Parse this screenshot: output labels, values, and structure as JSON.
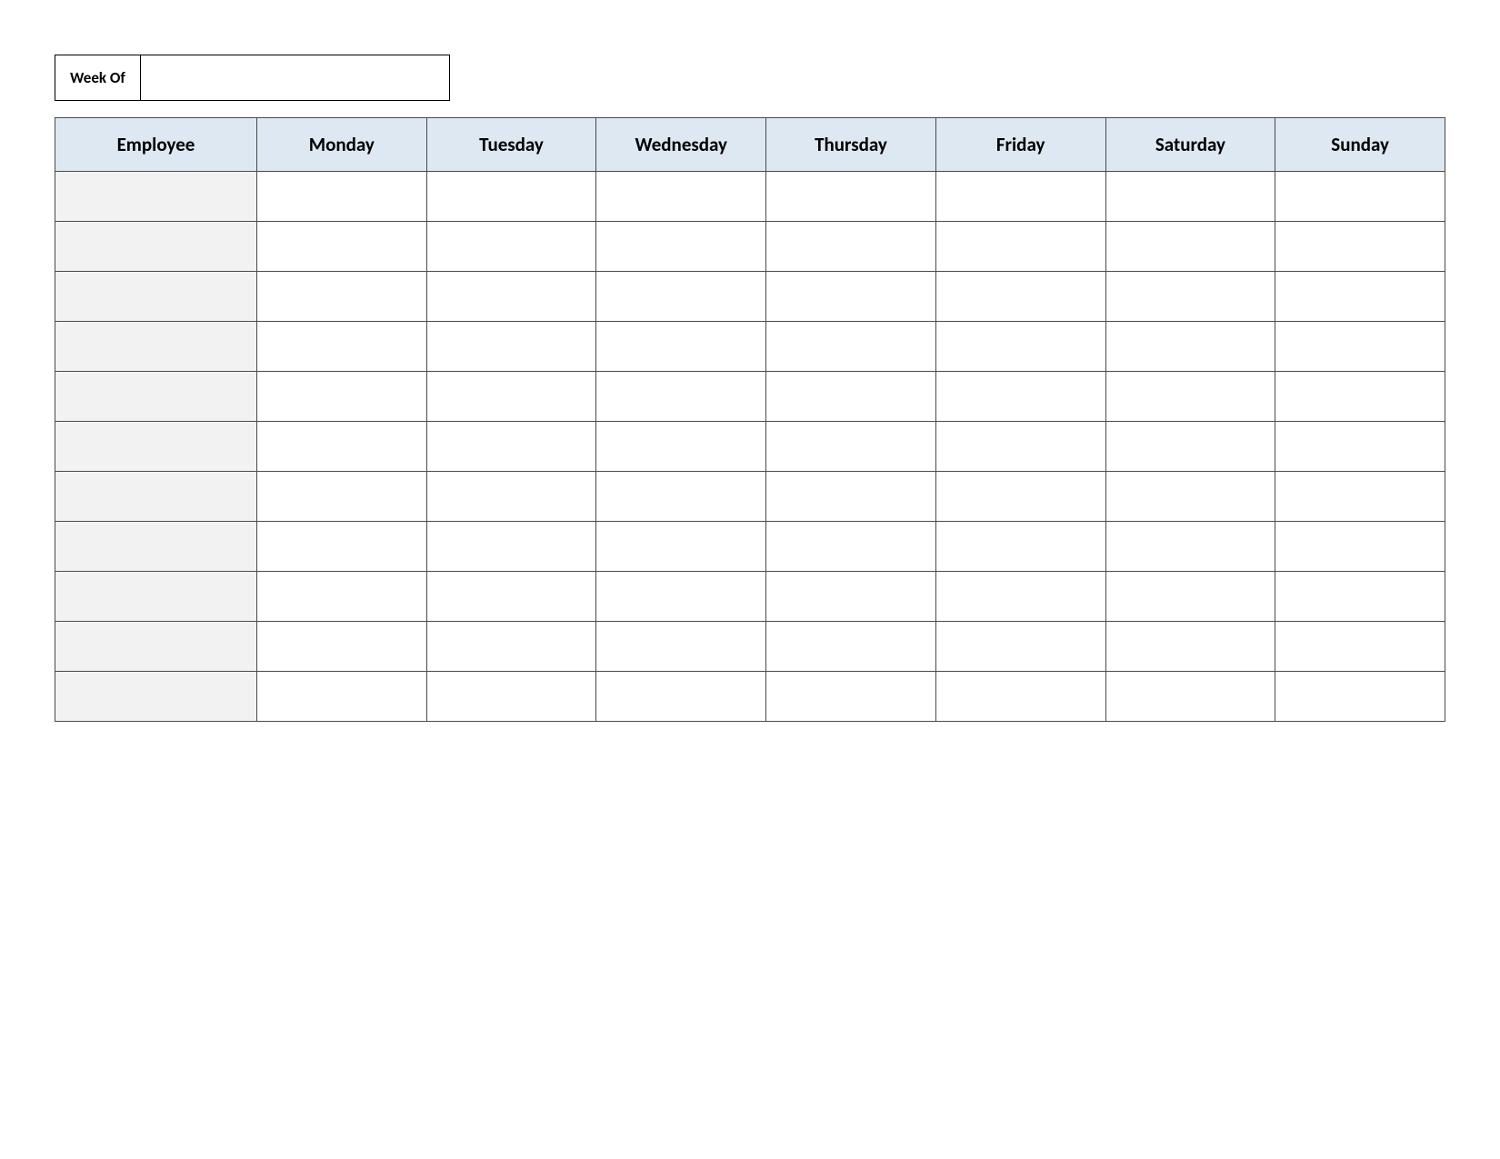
{
  "week_of": {
    "label": "Week Of",
    "value": ""
  },
  "table": {
    "headers": {
      "employee": "Employee",
      "monday": "Monday",
      "tuesday": "Tuesday",
      "wednesday": "Wednesday",
      "thursday": "Thursday",
      "friday": "Friday",
      "saturday": "Saturday",
      "sunday": "Sunday"
    },
    "rows": [
      {
        "employee": "",
        "monday": "",
        "tuesday": "",
        "wednesday": "",
        "thursday": "",
        "friday": "",
        "saturday": "",
        "sunday": ""
      },
      {
        "employee": "",
        "monday": "",
        "tuesday": "",
        "wednesday": "",
        "thursday": "",
        "friday": "",
        "saturday": "",
        "sunday": ""
      },
      {
        "employee": "",
        "monday": "",
        "tuesday": "",
        "wednesday": "",
        "thursday": "",
        "friday": "",
        "saturday": "",
        "sunday": ""
      },
      {
        "employee": "",
        "monday": "",
        "tuesday": "",
        "wednesday": "",
        "thursday": "",
        "friday": "",
        "saturday": "",
        "sunday": ""
      },
      {
        "employee": "",
        "monday": "",
        "tuesday": "",
        "wednesday": "",
        "thursday": "",
        "friday": "",
        "saturday": "",
        "sunday": ""
      },
      {
        "employee": "",
        "monday": "",
        "tuesday": "",
        "wednesday": "",
        "thursday": "",
        "friday": "",
        "saturday": "",
        "sunday": ""
      },
      {
        "employee": "",
        "monday": "",
        "tuesday": "",
        "wednesday": "",
        "thursday": "",
        "friday": "",
        "saturday": "",
        "sunday": ""
      },
      {
        "employee": "",
        "monday": "",
        "tuesday": "",
        "wednesday": "",
        "thursday": "",
        "friday": "",
        "saturday": "",
        "sunday": ""
      },
      {
        "employee": "",
        "monday": "",
        "tuesday": "",
        "wednesday": "",
        "thursday": "",
        "friday": "",
        "saturday": "",
        "sunday": ""
      },
      {
        "employee": "",
        "monday": "",
        "tuesday": "",
        "wednesday": "",
        "thursday": "",
        "friday": "",
        "saturday": "",
        "sunday": ""
      },
      {
        "employee": "",
        "monday": "",
        "tuesday": "",
        "wednesday": "",
        "thursday": "",
        "friday": "",
        "saturday": "",
        "sunday": ""
      }
    ]
  }
}
